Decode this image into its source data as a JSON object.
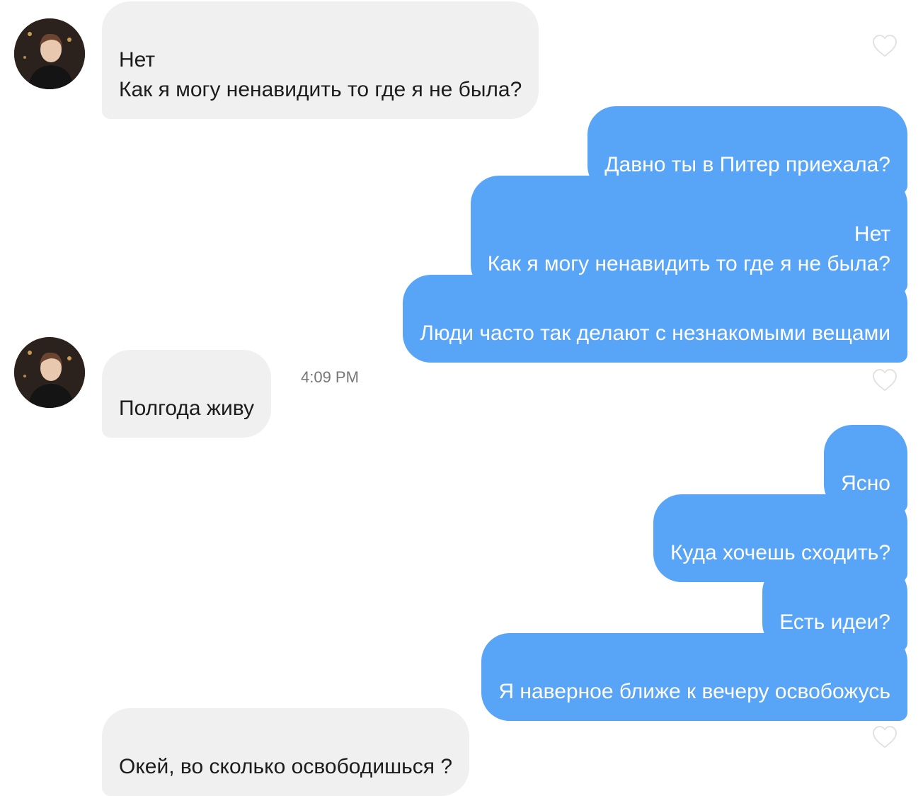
{
  "conversation": {
    "messages": [
      {
        "from": "them",
        "text": "Нет\nКак я могу ненавидить то где я не была?"
      },
      {
        "from": "me",
        "text": "Давно ты в Питер приехала?"
      },
      {
        "from": "me",
        "text": "Нет\nКак я могу ненавидить то где я не была?"
      },
      {
        "from": "me",
        "text": "Люди часто так делают с незнакомыми вещами"
      },
      {
        "from": "them",
        "text": "Полгода живу",
        "timestamp": "4:09 PM"
      },
      {
        "from": "me",
        "text": "Ясно"
      },
      {
        "from": "me",
        "text": "Куда хочешь сходить?"
      },
      {
        "from": "me",
        "text": "Есть идеи?"
      },
      {
        "from": "me",
        "text": "Я наверное ближе к вечеру освобожусь"
      },
      {
        "from": "them",
        "text": "Окей, во сколько освободишься ?"
      }
    ]
  },
  "icons": {
    "avatar": "user-photo-avatar",
    "like": "heart-outline-icon"
  },
  "colors": {
    "outgoing_bubble": "#58a4f6",
    "incoming_bubble": "#f0f0f0",
    "timestamp": "#767676",
    "heart_outline": "#e2e2e2"
  }
}
